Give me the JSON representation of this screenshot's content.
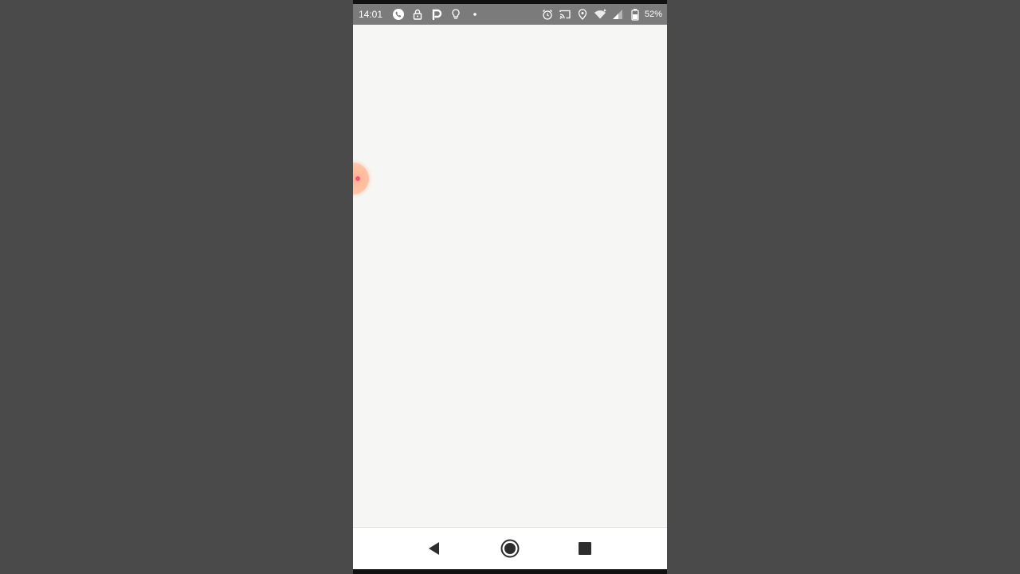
{
  "status_bar": {
    "time": "14:01",
    "battery_percent": "52%",
    "left_icons": [
      "whatsapp-icon",
      "lock-icon",
      "p-app-icon",
      "lightbulb-icon",
      "dot-icon"
    ],
    "right_icons": [
      "alarm-icon",
      "cast-icon",
      "location-icon",
      "wifi-icon",
      "signal-icon",
      "battery-icon"
    ]
  },
  "overlay": {
    "chat_head_color": "#ffb08f",
    "chat_head_dot_color": "#f0577a"
  },
  "nav_bar": {
    "buttons": [
      "back-icon",
      "home-icon",
      "recents-icon"
    ]
  },
  "colors": {
    "backdrop": "#4a4a4a",
    "status_bar": "#7b7b7b",
    "screen_background": "#f6f7f5"
  }
}
